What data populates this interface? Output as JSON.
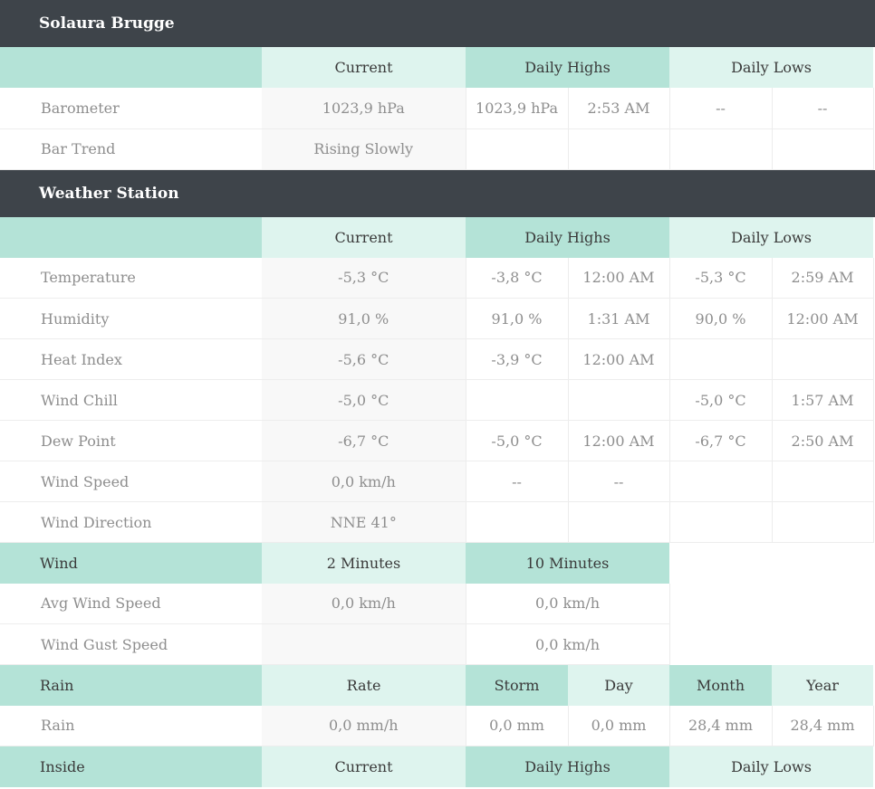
{
  "station": {
    "title": "Solaura Brugge"
  },
  "barometer_section": {
    "headers": {
      "current": "Current",
      "daily_highs": "Daily Highs",
      "daily_lows": "Daily Lows"
    },
    "rows": [
      {
        "label": "Barometer",
        "current": "1023,9 hPa",
        "high_value": "1023,9 hPa",
        "high_time": "2:53 AM",
        "low_value": "--",
        "low_time": "--"
      },
      {
        "label": "Bar Trend",
        "current": "Rising Slowly",
        "high_value": "",
        "high_time": "",
        "low_value": "",
        "low_time": ""
      }
    ]
  },
  "weather_station": {
    "title": "Weather Station",
    "headers": {
      "current": "Current",
      "daily_highs": "Daily Highs",
      "daily_lows": "Daily Lows"
    },
    "rows": [
      {
        "label": "Temperature",
        "current": "-5,3 °C",
        "high_value": "-3,8 °C",
        "high_time": "12:00 AM",
        "low_value": "-5,3 °C",
        "low_time": "2:59 AM"
      },
      {
        "label": "Humidity",
        "current": "91,0 %",
        "high_value": "91,0 %",
        "high_time": "1:31 AM",
        "low_value": "90,0 %",
        "low_time": "12:00 AM"
      },
      {
        "label": "Heat Index",
        "current": "-5,6 °C",
        "high_value": "-3,9 °C",
        "high_time": "12:00 AM",
        "low_value": "",
        "low_time": ""
      },
      {
        "label": "Wind Chill",
        "current": "-5,0 °C",
        "high_value": "",
        "high_time": "",
        "low_value": "-5,0 °C",
        "low_time": "1:57 AM"
      },
      {
        "label": "Dew Point",
        "current": "-6,7 °C",
        "high_value": "-5,0 °C",
        "high_time": "12:00 AM",
        "low_value": "-6,7 °C",
        "low_time": "2:50 AM"
      },
      {
        "label": "Wind Speed",
        "current": "0,0 km/h",
        "high_value": "--",
        "high_time": "--",
        "low_value": "",
        "low_time": ""
      },
      {
        "label": "Wind Direction",
        "current": "NNE 41°",
        "high_value": "",
        "high_time": "",
        "low_value": "",
        "low_time": ""
      }
    ]
  },
  "wind_section": {
    "headers": {
      "label": "Wind",
      "two_min": "2 Minutes",
      "ten_min": "10 Minutes"
    },
    "rows": [
      {
        "label": "Avg Wind Speed",
        "two_min": "0,0 km/h",
        "ten_min": "0,0 km/h"
      },
      {
        "label": "Wind Gust Speed",
        "two_min": "",
        "ten_min": "0,0 km/h"
      }
    ]
  },
  "rain_section": {
    "headers": {
      "label": "Rain",
      "rate": "Rate",
      "storm": "Storm",
      "day": "Day",
      "month": "Month",
      "year": "Year"
    },
    "rows": [
      {
        "label": "Rain",
        "rate": "0,0 mm/h",
        "storm": "0,0 mm",
        "day": "0,0 mm",
        "month": "28,4 mm",
        "year": "28,4 mm"
      }
    ]
  },
  "inside_section": {
    "headers": {
      "label": "Inside",
      "current": "Current",
      "daily_highs": "Daily Highs",
      "daily_lows": "Daily Lows"
    }
  },
  "colors": {
    "header_dark": "#3e444a",
    "teal_dark": "#b4e3d7",
    "teal_light": "#def4ee"
  }
}
